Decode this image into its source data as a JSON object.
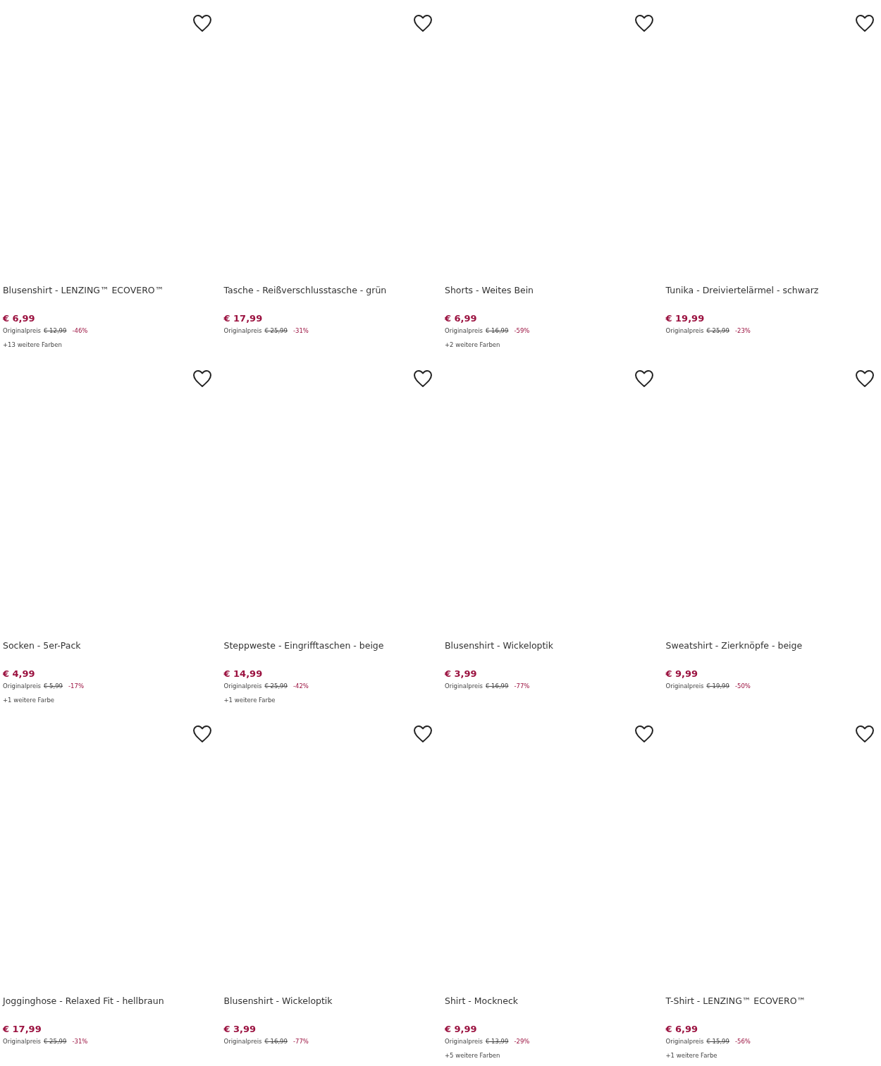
{
  "products": [
    {
      "name": "Blusenshirt - LENZING™ ECOVERO™",
      "price": "€ 6,99",
      "original_label": "Originalpreis",
      "original_price": "€ 12,99",
      "discount": "-46%",
      "colors": "+13 weitere Farben"
    },
    {
      "name": "Tasche - Reißverschlusstasche - grün",
      "price": "€ 17,99",
      "original_label": "Originalpreis",
      "original_price": "€ 25,99",
      "discount": "-31%"
    },
    {
      "name": "Shorts - Weites Bein",
      "price": "€ 6,99",
      "original_label": "Originalpreis",
      "original_price": "€ 16,99",
      "discount": "-59%",
      "colors": "+2 weitere Farben"
    },
    {
      "name": "Tunika - Dreiviertelärmel - schwarz",
      "price": "€ 19,99",
      "original_label": "Originalpreis",
      "original_price": "€ 25,99",
      "discount": "-23%"
    },
    {
      "name": "Socken - 5er-Pack",
      "price": "€ 4,99",
      "original_label": "Originalpreis",
      "original_price": "€ 5,99",
      "discount": "-17%",
      "colors": "+1 weitere Farbe"
    },
    {
      "name": "Steppweste - Eingrifftaschen - beige",
      "price": "€ 14,99",
      "original_label": "Originalpreis",
      "original_price": "€ 25,99",
      "discount": "-42%",
      "colors": "+1 weitere Farbe"
    },
    {
      "name": "Blusenshirt - Wickeloptik",
      "price": "€ 3,99",
      "original_label": "Originalpreis",
      "original_price": "€ 16,99",
      "discount": "-77%"
    },
    {
      "name": "Sweatshirt - Zierknöpfe - beige",
      "price": "€ 9,99",
      "original_label": "Originalpreis",
      "original_price": "€ 19,99",
      "discount": "-50%"
    },
    {
      "name": "Jogginghose - Relaxed Fit - hellbraun",
      "price": "€ 17,99",
      "original_label": "Originalpreis",
      "original_price": "€ 25,99",
      "discount": "-31%"
    },
    {
      "name": "Blusenshirt - Wickeloptik",
      "price": "€ 3,99",
      "original_label": "Originalpreis",
      "original_price": "€ 16,99",
      "discount": "-77%"
    },
    {
      "name": "Shirt - Mockneck",
      "price": "€ 9,99",
      "original_label": "Originalpreis",
      "original_price": "€ 13,99",
      "discount": "-29%",
      "colors": "+5 weitere Farben"
    },
    {
      "name": "T-Shirt - LENZING™ ECOVERO™",
      "price": "€ 6,99",
      "original_label": "Originalpreis",
      "original_price": "€ 15,99",
      "discount": "-56%",
      "colors": "+1 weitere Farbe"
    }
  ]
}
